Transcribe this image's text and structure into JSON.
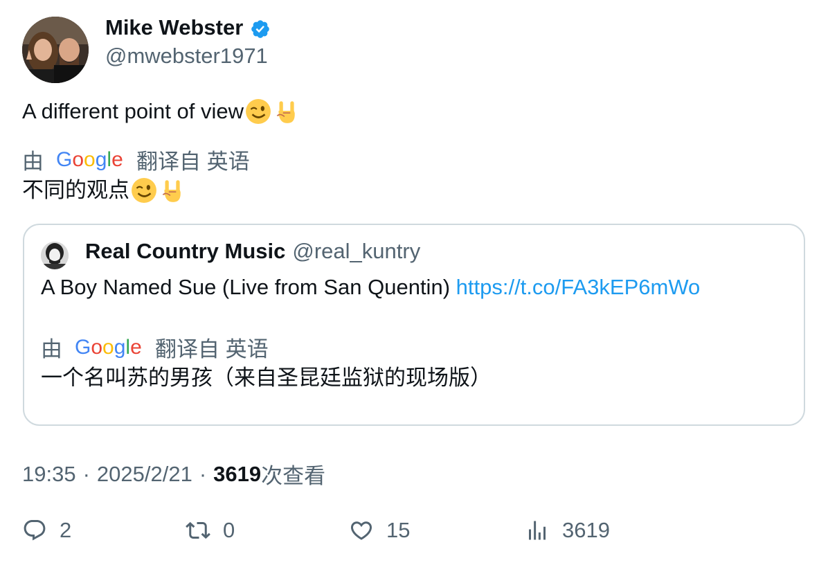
{
  "author": {
    "name": "Mike Webster",
    "handle": "@mwebster1971",
    "verified_color": "#1d9bf0"
  },
  "tweet": {
    "text": "A different point of view",
    "emojis": [
      "winking-face",
      "sign-of-the-horns"
    ],
    "translation": {
      "by_label": "由",
      "provider": "Google",
      "from_label": "翻译自 英语",
      "text": "不同的观点"
    }
  },
  "quote": {
    "name": "Real Country Music",
    "handle": "@real_kuntry",
    "text": "A Boy Named Sue (Live from San Quentin) ",
    "link": "https://t.co/FA3kEP6mWo",
    "translation": {
      "by_label": "由",
      "provider": "Google",
      "from_label": "翻译自 英语",
      "text": "一个名叫苏的男孩（来自圣昆廷监狱的现场版）"
    }
  },
  "meta": {
    "time": "19:35",
    "separator": "·",
    "date": "2025/2/21",
    "views_count": "3619",
    "views_label": "次查看"
  },
  "actions": {
    "replies": "2",
    "retweets": "0",
    "likes": "15",
    "views": "3619"
  },
  "colors": {
    "text": "#0f1419",
    "secondary": "#536471",
    "link": "#1d9bf0",
    "border": "#cfd9de"
  }
}
